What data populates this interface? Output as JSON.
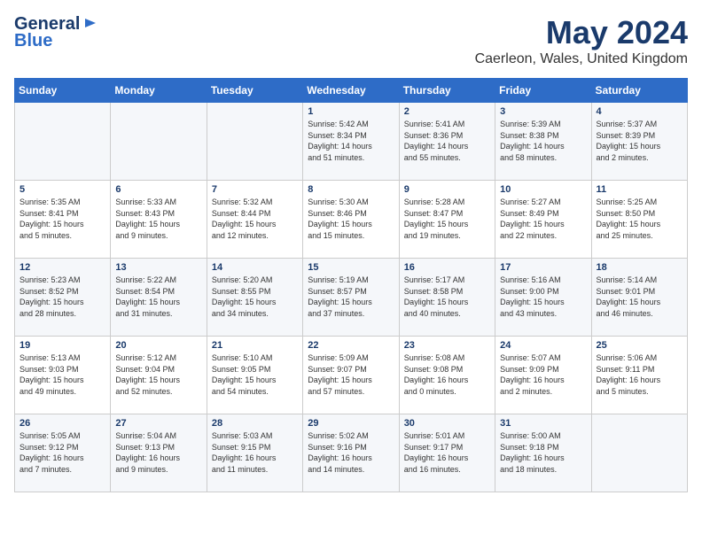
{
  "logo": {
    "line1": "General",
    "line2": "Blue"
  },
  "title": "May 2024",
  "subtitle": "Caerleon, Wales, United Kingdom",
  "days_of_week": [
    "Sunday",
    "Monday",
    "Tuesday",
    "Wednesday",
    "Thursday",
    "Friday",
    "Saturday"
  ],
  "weeks": [
    [
      {
        "day": "",
        "info": ""
      },
      {
        "day": "",
        "info": ""
      },
      {
        "day": "",
        "info": ""
      },
      {
        "day": "1",
        "info": "Sunrise: 5:42 AM\nSunset: 8:34 PM\nDaylight: 14 hours\nand 51 minutes."
      },
      {
        "day": "2",
        "info": "Sunrise: 5:41 AM\nSunset: 8:36 PM\nDaylight: 14 hours\nand 55 minutes."
      },
      {
        "day": "3",
        "info": "Sunrise: 5:39 AM\nSunset: 8:38 PM\nDaylight: 14 hours\nand 58 minutes."
      },
      {
        "day": "4",
        "info": "Sunrise: 5:37 AM\nSunset: 8:39 PM\nDaylight: 15 hours\nand 2 minutes."
      }
    ],
    [
      {
        "day": "5",
        "info": "Sunrise: 5:35 AM\nSunset: 8:41 PM\nDaylight: 15 hours\nand 5 minutes."
      },
      {
        "day": "6",
        "info": "Sunrise: 5:33 AM\nSunset: 8:43 PM\nDaylight: 15 hours\nand 9 minutes."
      },
      {
        "day": "7",
        "info": "Sunrise: 5:32 AM\nSunset: 8:44 PM\nDaylight: 15 hours\nand 12 minutes."
      },
      {
        "day": "8",
        "info": "Sunrise: 5:30 AM\nSunset: 8:46 PM\nDaylight: 15 hours\nand 15 minutes."
      },
      {
        "day": "9",
        "info": "Sunrise: 5:28 AM\nSunset: 8:47 PM\nDaylight: 15 hours\nand 19 minutes."
      },
      {
        "day": "10",
        "info": "Sunrise: 5:27 AM\nSunset: 8:49 PM\nDaylight: 15 hours\nand 22 minutes."
      },
      {
        "day": "11",
        "info": "Sunrise: 5:25 AM\nSunset: 8:50 PM\nDaylight: 15 hours\nand 25 minutes."
      }
    ],
    [
      {
        "day": "12",
        "info": "Sunrise: 5:23 AM\nSunset: 8:52 PM\nDaylight: 15 hours\nand 28 minutes."
      },
      {
        "day": "13",
        "info": "Sunrise: 5:22 AM\nSunset: 8:54 PM\nDaylight: 15 hours\nand 31 minutes."
      },
      {
        "day": "14",
        "info": "Sunrise: 5:20 AM\nSunset: 8:55 PM\nDaylight: 15 hours\nand 34 minutes."
      },
      {
        "day": "15",
        "info": "Sunrise: 5:19 AM\nSunset: 8:57 PM\nDaylight: 15 hours\nand 37 minutes."
      },
      {
        "day": "16",
        "info": "Sunrise: 5:17 AM\nSunset: 8:58 PM\nDaylight: 15 hours\nand 40 minutes."
      },
      {
        "day": "17",
        "info": "Sunrise: 5:16 AM\nSunset: 9:00 PM\nDaylight: 15 hours\nand 43 minutes."
      },
      {
        "day": "18",
        "info": "Sunrise: 5:14 AM\nSunset: 9:01 PM\nDaylight: 15 hours\nand 46 minutes."
      }
    ],
    [
      {
        "day": "19",
        "info": "Sunrise: 5:13 AM\nSunset: 9:03 PM\nDaylight: 15 hours\nand 49 minutes."
      },
      {
        "day": "20",
        "info": "Sunrise: 5:12 AM\nSunset: 9:04 PM\nDaylight: 15 hours\nand 52 minutes."
      },
      {
        "day": "21",
        "info": "Sunrise: 5:10 AM\nSunset: 9:05 PM\nDaylight: 15 hours\nand 54 minutes."
      },
      {
        "day": "22",
        "info": "Sunrise: 5:09 AM\nSunset: 9:07 PM\nDaylight: 15 hours\nand 57 minutes."
      },
      {
        "day": "23",
        "info": "Sunrise: 5:08 AM\nSunset: 9:08 PM\nDaylight: 16 hours\nand 0 minutes."
      },
      {
        "day": "24",
        "info": "Sunrise: 5:07 AM\nSunset: 9:09 PM\nDaylight: 16 hours\nand 2 minutes."
      },
      {
        "day": "25",
        "info": "Sunrise: 5:06 AM\nSunset: 9:11 PM\nDaylight: 16 hours\nand 5 minutes."
      }
    ],
    [
      {
        "day": "26",
        "info": "Sunrise: 5:05 AM\nSunset: 9:12 PM\nDaylight: 16 hours\nand 7 minutes."
      },
      {
        "day": "27",
        "info": "Sunrise: 5:04 AM\nSunset: 9:13 PM\nDaylight: 16 hours\nand 9 minutes."
      },
      {
        "day": "28",
        "info": "Sunrise: 5:03 AM\nSunset: 9:15 PM\nDaylight: 16 hours\nand 11 minutes."
      },
      {
        "day": "29",
        "info": "Sunrise: 5:02 AM\nSunset: 9:16 PM\nDaylight: 16 hours\nand 14 minutes."
      },
      {
        "day": "30",
        "info": "Sunrise: 5:01 AM\nSunset: 9:17 PM\nDaylight: 16 hours\nand 16 minutes."
      },
      {
        "day": "31",
        "info": "Sunrise: 5:00 AM\nSunset: 9:18 PM\nDaylight: 16 hours\nand 18 minutes."
      },
      {
        "day": "",
        "info": ""
      }
    ]
  ]
}
